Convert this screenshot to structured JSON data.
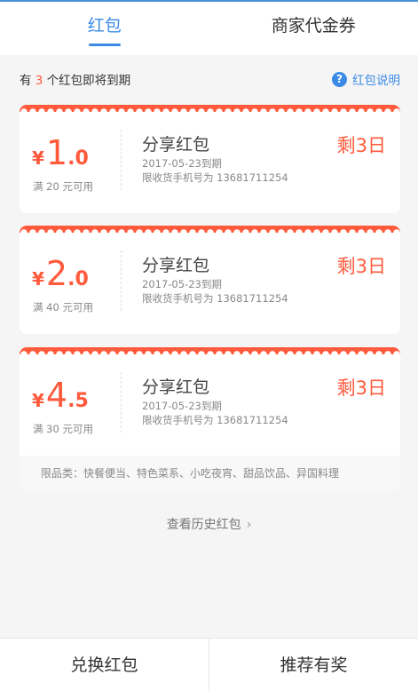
{
  "tabs": [
    "红包",
    "商家代金券"
  ],
  "notice": {
    "prefix": "有",
    "count": "3",
    "suffix": "个红包即将到期",
    "help_label": "红包说明"
  },
  "cards": [
    {
      "yen": "¥",
      "int": "1",
      "dec": ".0",
      "cond": "满 20 元可用",
      "title": "分享红包",
      "expire": "2017-05-23到期",
      "phone": "限收货手机号为 13681711254",
      "remain": "剩3日"
    },
    {
      "yen": "¥",
      "int": "2",
      "dec": ".0",
      "cond": "满 40 元可用",
      "title": "分享红包",
      "expire": "2017-05-23到期",
      "phone": "限收货手机号为 13681711254",
      "remain": "剩3日"
    },
    {
      "yen": "¥",
      "int": "4",
      "dec": ".5",
      "cond": "满 30 元可用",
      "title": "分享红包",
      "expire": "2017-05-23到期",
      "phone": "限收货手机号为 13681711254",
      "remain": "剩3日"
    }
  ],
  "restrict": "限品类：快餐便当、特色菜系、小吃夜宵、甜品饮品、异国料理",
  "history_label": "查看历史红包",
  "bottom": [
    "兑换红包",
    "推荐有奖"
  ]
}
